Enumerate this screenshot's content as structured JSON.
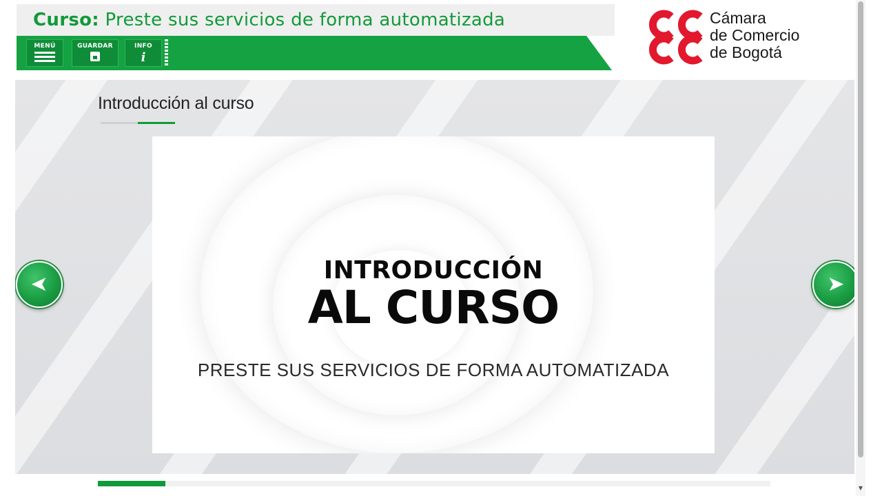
{
  "header": {
    "course_prefix": "Curso:",
    "course_title": "Preste sus servicios de forma automatizada",
    "toolbar": {
      "menu_label": "MENÚ",
      "save_label": "GUARDAR",
      "info_label": "INFO",
      "info_glyph": "i"
    },
    "logo": {
      "line1": "Cámara",
      "line2": "de Comercio",
      "line3": "de Bogotá",
      "color": "#e2182d"
    }
  },
  "section": {
    "title": "Introducción al curso"
  },
  "slide": {
    "heading_line1": "INTRODUCCIÓN",
    "heading_line2": "AL CURSO",
    "subtitle": "PRESTE SUS SERVICIOS DE FORMA AUTOMATIZADA"
  },
  "navigation": {
    "prev_glyph": "➤",
    "next_glyph": "➤"
  },
  "progress": {
    "fraction": 0.1
  },
  "colors": {
    "accent_green": "#15a243",
    "title_green": "#119a3a",
    "brand_red": "#e2182d"
  }
}
